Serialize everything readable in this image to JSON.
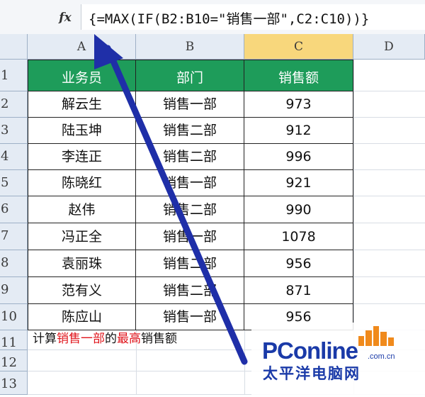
{
  "formula_bar": {
    "fx_label": "fx",
    "formula": "{=MAX(IF(B2:B10=\"销售一部\",C2:C10))}"
  },
  "columns": [
    "A",
    "B",
    "C",
    "D"
  ],
  "rows": [
    "1",
    "2",
    "3",
    "4",
    "5",
    "6",
    "7",
    "8",
    "9",
    "10",
    "11",
    "12",
    "13"
  ],
  "table": {
    "headers": [
      "业务员",
      "部门",
      "销售额"
    ],
    "rows": [
      [
        "解云生",
        "销售一部",
        "973"
      ],
      [
        "陆玉坤",
        "销售二部",
        "912"
      ],
      [
        "李连正",
        "销售二部",
        "996"
      ],
      [
        "陈晓红",
        "销售一部",
        "921"
      ],
      [
        "赵伟",
        "销售二部",
        "990"
      ],
      [
        "冯正全",
        "销售一部",
        "1078"
      ],
      [
        "袁丽珠",
        "销售二部",
        "956"
      ],
      [
        "范有义",
        "销售二部",
        "871"
      ],
      [
        "陈应山",
        "销售一部",
        "956"
      ]
    ]
  },
  "note": {
    "part1": "计算",
    "part2": "销售一部",
    "part3": "的",
    "part4": "最高",
    "part5": "销售额"
  },
  "watermark": {
    "brand": "PConline",
    "domain": ".com.cn",
    "subtitle": "太平洋电脑网"
  },
  "colors": {
    "header_fill": "#1e9c5a",
    "selected_column": "#f8d77c",
    "arrow": "#1f2fa8",
    "highlight_text": "#e0141b"
  }
}
